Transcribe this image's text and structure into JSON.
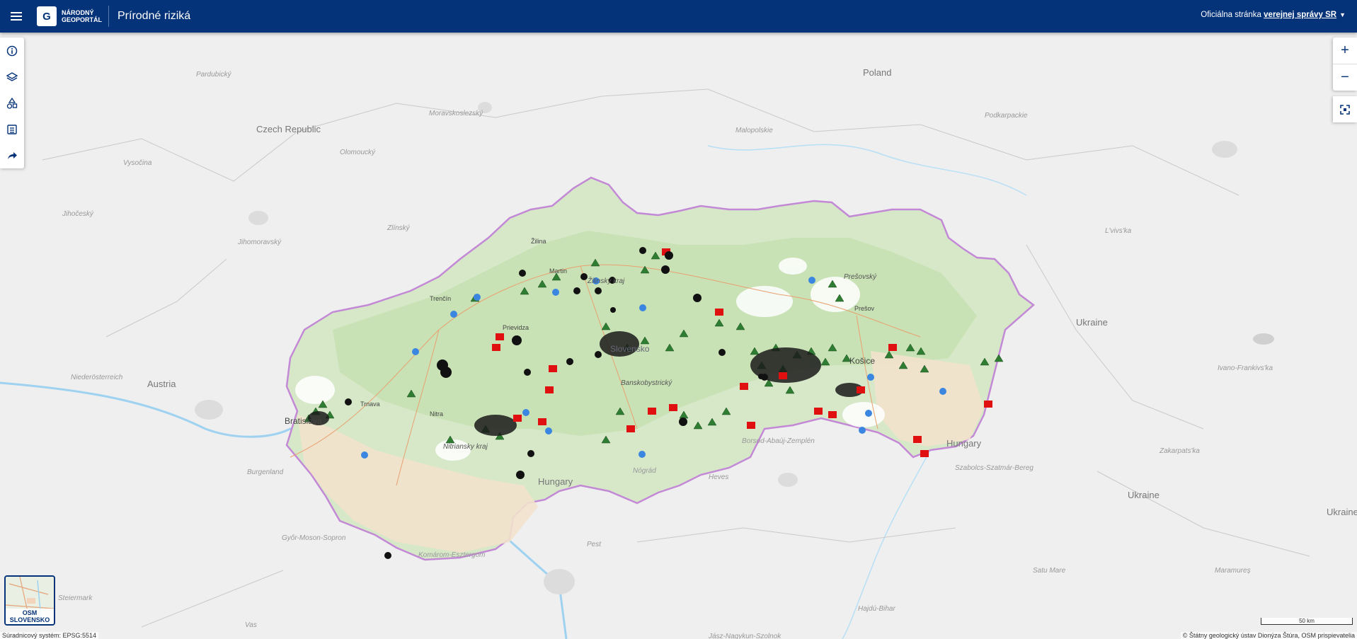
{
  "header": {
    "logo_letter": "G",
    "logo_text": "Národný geoportál",
    "app_title": "Prírodné riziká",
    "gov_prefix": "Oficiálna stránka",
    "gov_link": "verejnej správy SR"
  },
  "toolbar": {
    "items": [
      {
        "icon": "info-icon"
      },
      {
        "icon": "layers-icon"
      },
      {
        "icon": "shapes-icon"
      },
      {
        "icon": "legend-list-icon"
      },
      {
        "icon": "share-icon"
      }
    ]
  },
  "zoom": {
    "in": "+",
    "out": "−"
  },
  "basemap": {
    "label_line1": "OSM",
    "label_line2": "SLOVENSKO"
  },
  "status": {
    "coordinate_system": "Súradnicový systém: EPSG:5514",
    "attribution": "© Štátny geologický ústav Dionýza Štúra, OSM prispievatelia",
    "scale_label": "50 km"
  },
  "map_labels": {
    "countries": [
      "Poland",
      "Czech Republic",
      "Austria",
      "Hungary",
      "Hungary",
      "Ukraine",
      "Ukraine",
      "Ukraine"
    ],
    "regions": [
      "Pardubický",
      "Moravskoslezský",
      "Olomoucký",
      "Vysočina",
      "Jihočeský",
      "Jihomoravský",
      "Zlínský",
      "Malopolskie",
      "Podkarpackie",
      "L'vivs'ka",
      "Niederösterreich",
      "Burgenland",
      "Győr-Moson-Sopron",
      "Komárom-Esztergom",
      "Nógrád",
      "Borsod-Abaúj-Zemplén",
      "Heves",
      "Szabolcs-Szatmár-Bereg",
      "Zakarpats'ka",
      "Ivano-Frankivs'ka",
      "Pest",
      "Jász-Nagykun-Szolnok",
      "Hajdú-Bihar",
      "Satu Mare",
      "Maramureș",
      "Steiermark",
      "Vas",
      "Slovensko",
      "Žilinský kraj",
      "Banskobystrický",
      "Prešovský",
      "Nitriansky kraj",
      "Trnava"
    ],
    "cities": [
      "Bratislava",
      "Trenčín",
      "Žilina",
      "Martin",
      "Prievidza",
      "Nitra",
      "Košice",
      "Prešov"
    ]
  },
  "legend_colors": {
    "header_bg": "#05337a",
    "slovakia_fill": "#d6e8c8",
    "border": "#c389d6",
    "landslide": "#2f7d32",
    "hazard_red": "#e01010",
    "point_blue": "#3a86e0",
    "point_black": "#111111"
  }
}
